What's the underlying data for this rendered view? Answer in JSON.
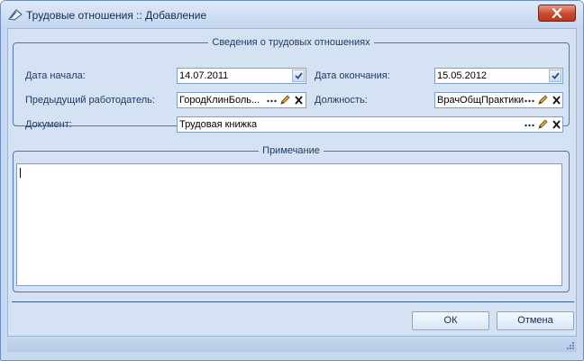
{
  "window": {
    "title": "Трудовые отношения :: Добавление"
  },
  "group_employment": {
    "legend": "Сведения о трудовых отношениях",
    "start_date": {
      "label": "Дата начала:",
      "value": "14.07.2011"
    },
    "end_date": {
      "label": "Дата окончания:",
      "value": "15.05.2012"
    },
    "previous_employer": {
      "label": "Предыдущий работодатель:",
      "value": "ГородКлинБоль..."
    },
    "position": {
      "label": "Должность:",
      "value": "ВрачОбщПрактики"
    },
    "document": {
      "label": "Документ:",
      "value": "Трудовая книжка"
    }
  },
  "group_note": {
    "legend": "Примечание",
    "value": ""
  },
  "buttons": {
    "ok": "ОК",
    "cancel": "Отмена"
  },
  "icons": {
    "window": "form-icon",
    "lookup": "ellipsis-icon",
    "edit": "pencil-icon",
    "clear": "clear-x-icon",
    "dropdown": "dropdown-check-icon"
  },
  "colors": {
    "window_bg": "#c6d7ee",
    "group_border": "#4d76b2",
    "close_button": "#c9482c"
  }
}
